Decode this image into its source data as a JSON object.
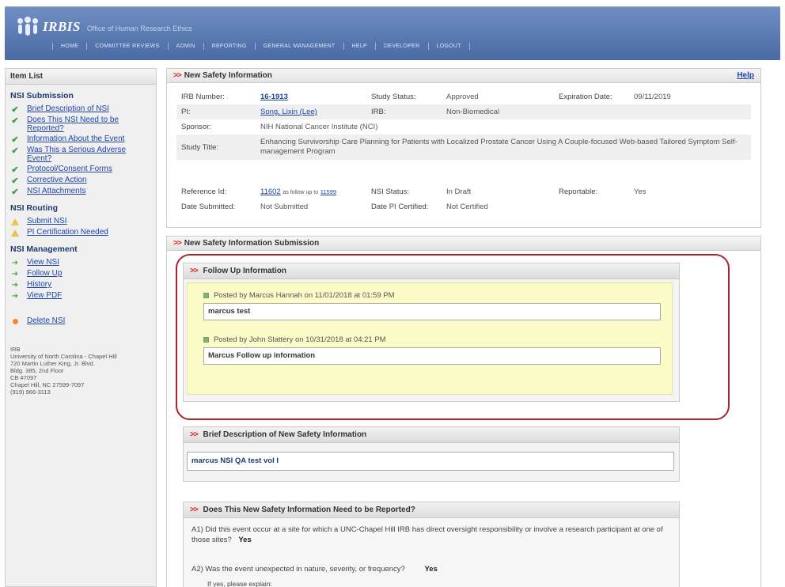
{
  "header": {
    "app_name": "IRBIS",
    "app_subtitle": "Office of Human Research Ethics",
    "nav": [
      "HOME",
      "COMMITTEE REVIEWS",
      "ADMIN",
      "REPORTING",
      "GENERAL MANAGEMENT",
      "HELP",
      "DEVELOPER",
      "LOGOUT"
    ]
  },
  "sidebar": {
    "title": "Item List",
    "sections": [
      {
        "title": "NSI Submission",
        "items": [
          {
            "label": "Brief Description of NSI",
            "icon": "check-icon"
          },
          {
            "label": "Does This NSI Need to be Reported?",
            "icon": "check-icon"
          },
          {
            "label": "Information About the Event",
            "icon": "check-icon"
          },
          {
            "label": "Was This a Serious Adverse Event?",
            "icon": "check-icon"
          },
          {
            "label": "Protocol/Consent Forms",
            "icon": "check-icon"
          },
          {
            "label": "Corrective Action",
            "icon": "check-icon"
          },
          {
            "label": "NSI Attachments",
            "icon": "check-icon"
          }
        ]
      },
      {
        "title": "NSI Routing",
        "items": [
          {
            "label": "Submit NSI",
            "icon": "warning-icon"
          },
          {
            "label": "PI Certification Needed",
            "icon": "warning-icon"
          }
        ]
      },
      {
        "title": "NSI Management",
        "items": [
          {
            "label": "View NSI",
            "icon": "arrow-icon"
          },
          {
            "label": "Follow Up",
            "icon": "arrow-icon"
          },
          {
            "label": "History",
            "icon": "arrow-icon"
          },
          {
            "label": "View PDF",
            "icon": "arrow-icon"
          }
        ]
      }
    ],
    "delete_label": "Delete NSI",
    "address": [
      "IRB",
      "University of North Carolina - Chapel Hill",
      "720 Martin Luther King, Jr. Blvd.",
      "Bldg. 385, 2nd Floor",
      "CB #7097",
      "Chapel Hill, NC 27599-7097",
      "(919) 966-3113"
    ]
  },
  "nsi_panel": {
    "title": "New Safety Information",
    "help": "Help",
    "irb_number_label": "IRB Number:",
    "irb_number": "16-1913",
    "study_status_label": "Study Status:",
    "study_status": "Approved",
    "expiration_label": "Expiration Date:",
    "expiration": "09/11/2019",
    "pi_label": "PI:",
    "pi": "Song, Lixin (Lee)",
    "irb_label": "IRB:",
    "irb": "Non-Biomedical",
    "sponsor_label": "Sponsor:",
    "sponsor": "NIH National Cancer Institute (NCI)",
    "study_title_label": "Study Title:",
    "study_title": "Enhancing Survivorship Care Planning for Patients with Localized Prostate Cancer Using A Couple-focused Web-based Tailored Symptom Self-management Program",
    "reference_label": "Reference Id:",
    "reference_id": "11602",
    "followup_text": "as follow up to",
    "followup_id": "11599",
    "nsi_status_label": "NSI Status:",
    "nsi_status": "In Draft",
    "reportable_label": "Reportable:",
    "reportable": "Yes",
    "date_submitted_label": "Date Submitted:",
    "date_submitted": "Not Submitted",
    "date_pi_label": "Date PI Certified:",
    "date_pi": "Not Certified"
  },
  "submission_panel": {
    "title": "New Safety Information Submission",
    "follow_up": {
      "title": "Follow Up Information",
      "posts": [
        {
          "posted": "Posted by Marcus Hannah on 11/01/2018 at 01:59 PM",
          "text": "marcus test"
        },
        {
          "posted": "Posted by John Slattery on 10/31/2018 at 04:21 PM",
          "text": "Marcus Follow up information"
        }
      ]
    },
    "brief": {
      "title": "Brief Description of New Safety Information",
      "text": "marcus NSI QA test vol I"
    },
    "reported": {
      "title": "Does This New Safety Information Need to be Reported?",
      "q1": "A1) Did this event occur at a site for which a UNC-Chapel Hill IRB has direct oversight responsibility or involve a research participant at one of those sites?",
      "a1": "Yes",
      "q2": "A2) Was the event unexpected in nature, severity, or frequency?",
      "a2": "Yes",
      "q2_follow": "If yes, please explain:"
    }
  }
}
